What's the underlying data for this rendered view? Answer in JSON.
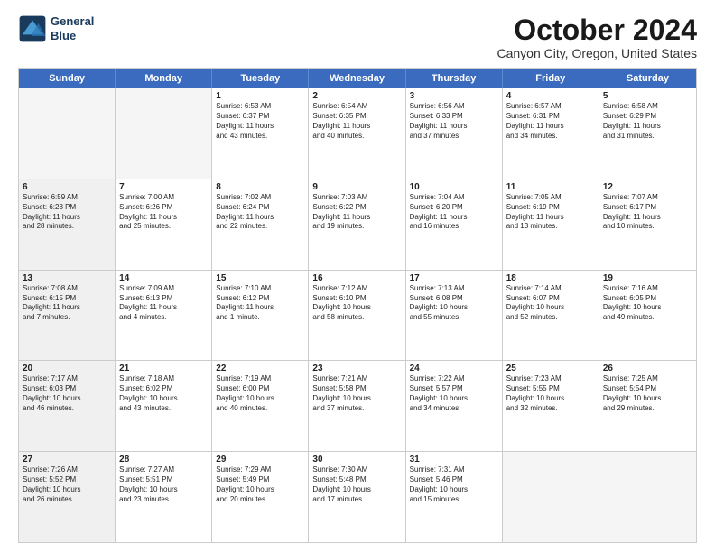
{
  "logo": {
    "line1": "General",
    "line2": "Blue"
  },
  "title": "October 2024",
  "subtitle": "Canyon City, Oregon, United States",
  "days_of_week": [
    "Sunday",
    "Monday",
    "Tuesday",
    "Wednesday",
    "Thursday",
    "Friday",
    "Saturday"
  ],
  "weeks": [
    [
      {
        "day": "",
        "empty": true
      },
      {
        "day": "",
        "empty": true
      },
      {
        "day": "1",
        "l1": "Sunrise: 6:53 AM",
        "l2": "Sunset: 6:37 PM",
        "l3": "Daylight: 11 hours",
        "l4": "and 43 minutes."
      },
      {
        "day": "2",
        "l1": "Sunrise: 6:54 AM",
        "l2": "Sunset: 6:35 PM",
        "l3": "Daylight: 11 hours",
        "l4": "and 40 minutes."
      },
      {
        "day": "3",
        "l1": "Sunrise: 6:56 AM",
        "l2": "Sunset: 6:33 PM",
        "l3": "Daylight: 11 hours",
        "l4": "and 37 minutes."
      },
      {
        "day": "4",
        "l1": "Sunrise: 6:57 AM",
        "l2": "Sunset: 6:31 PM",
        "l3": "Daylight: 11 hours",
        "l4": "and 34 minutes."
      },
      {
        "day": "5",
        "l1": "Sunrise: 6:58 AM",
        "l2": "Sunset: 6:29 PM",
        "l3": "Daylight: 11 hours",
        "l4": "and 31 minutes."
      }
    ],
    [
      {
        "day": "6",
        "shaded": true,
        "l1": "Sunrise: 6:59 AM",
        "l2": "Sunset: 6:28 PM",
        "l3": "Daylight: 11 hours",
        "l4": "and 28 minutes."
      },
      {
        "day": "7",
        "l1": "Sunrise: 7:00 AM",
        "l2": "Sunset: 6:26 PM",
        "l3": "Daylight: 11 hours",
        "l4": "and 25 minutes."
      },
      {
        "day": "8",
        "l1": "Sunrise: 7:02 AM",
        "l2": "Sunset: 6:24 PM",
        "l3": "Daylight: 11 hours",
        "l4": "and 22 minutes."
      },
      {
        "day": "9",
        "l1": "Sunrise: 7:03 AM",
        "l2": "Sunset: 6:22 PM",
        "l3": "Daylight: 11 hours",
        "l4": "and 19 minutes."
      },
      {
        "day": "10",
        "l1": "Sunrise: 7:04 AM",
        "l2": "Sunset: 6:20 PM",
        "l3": "Daylight: 11 hours",
        "l4": "and 16 minutes."
      },
      {
        "day": "11",
        "l1": "Sunrise: 7:05 AM",
        "l2": "Sunset: 6:19 PM",
        "l3": "Daylight: 11 hours",
        "l4": "and 13 minutes."
      },
      {
        "day": "12",
        "l1": "Sunrise: 7:07 AM",
        "l2": "Sunset: 6:17 PM",
        "l3": "Daylight: 11 hours",
        "l4": "and 10 minutes."
      }
    ],
    [
      {
        "day": "13",
        "shaded": true,
        "l1": "Sunrise: 7:08 AM",
        "l2": "Sunset: 6:15 PM",
        "l3": "Daylight: 11 hours",
        "l4": "and 7 minutes."
      },
      {
        "day": "14",
        "l1": "Sunrise: 7:09 AM",
        "l2": "Sunset: 6:13 PM",
        "l3": "Daylight: 11 hours",
        "l4": "and 4 minutes."
      },
      {
        "day": "15",
        "l1": "Sunrise: 7:10 AM",
        "l2": "Sunset: 6:12 PM",
        "l3": "Daylight: 11 hours",
        "l4": "and 1 minute."
      },
      {
        "day": "16",
        "l1": "Sunrise: 7:12 AM",
        "l2": "Sunset: 6:10 PM",
        "l3": "Daylight: 10 hours",
        "l4": "and 58 minutes."
      },
      {
        "day": "17",
        "l1": "Sunrise: 7:13 AM",
        "l2": "Sunset: 6:08 PM",
        "l3": "Daylight: 10 hours",
        "l4": "and 55 minutes."
      },
      {
        "day": "18",
        "l1": "Sunrise: 7:14 AM",
        "l2": "Sunset: 6:07 PM",
        "l3": "Daylight: 10 hours",
        "l4": "and 52 minutes."
      },
      {
        "day": "19",
        "l1": "Sunrise: 7:16 AM",
        "l2": "Sunset: 6:05 PM",
        "l3": "Daylight: 10 hours",
        "l4": "and 49 minutes."
      }
    ],
    [
      {
        "day": "20",
        "shaded": true,
        "l1": "Sunrise: 7:17 AM",
        "l2": "Sunset: 6:03 PM",
        "l3": "Daylight: 10 hours",
        "l4": "and 46 minutes."
      },
      {
        "day": "21",
        "l1": "Sunrise: 7:18 AM",
        "l2": "Sunset: 6:02 PM",
        "l3": "Daylight: 10 hours",
        "l4": "and 43 minutes."
      },
      {
        "day": "22",
        "l1": "Sunrise: 7:19 AM",
        "l2": "Sunset: 6:00 PM",
        "l3": "Daylight: 10 hours",
        "l4": "and 40 minutes."
      },
      {
        "day": "23",
        "l1": "Sunrise: 7:21 AM",
        "l2": "Sunset: 5:58 PM",
        "l3": "Daylight: 10 hours",
        "l4": "and 37 minutes."
      },
      {
        "day": "24",
        "l1": "Sunrise: 7:22 AM",
        "l2": "Sunset: 5:57 PM",
        "l3": "Daylight: 10 hours",
        "l4": "and 34 minutes."
      },
      {
        "day": "25",
        "l1": "Sunrise: 7:23 AM",
        "l2": "Sunset: 5:55 PM",
        "l3": "Daylight: 10 hours",
        "l4": "and 32 minutes."
      },
      {
        "day": "26",
        "l1": "Sunrise: 7:25 AM",
        "l2": "Sunset: 5:54 PM",
        "l3": "Daylight: 10 hours",
        "l4": "and 29 minutes."
      }
    ],
    [
      {
        "day": "27",
        "shaded": true,
        "l1": "Sunrise: 7:26 AM",
        "l2": "Sunset: 5:52 PM",
        "l3": "Daylight: 10 hours",
        "l4": "and 26 minutes."
      },
      {
        "day": "28",
        "l1": "Sunrise: 7:27 AM",
        "l2": "Sunset: 5:51 PM",
        "l3": "Daylight: 10 hours",
        "l4": "and 23 minutes."
      },
      {
        "day": "29",
        "l1": "Sunrise: 7:29 AM",
        "l2": "Sunset: 5:49 PM",
        "l3": "Daylight: 10 hours",
        "l4": "and 20 minutes."
      },
      {
        "day": "30",
        "l1": "Sunrise: 7:30 AM",
        "l2": "Sunset: 5:48 PM",
        "l3": "Daylight: 10 hours",
        "l4": "and 17 minutes."
      },
      {
        "day": "31",
        "l1": "Sunrise: 7:31 AM",
        "l2": "Sunset: 5:46 PM",
        "l3": "Daylight: 10 hours",
        "l4": "and 15 minutes."
      },
      {
        "day": "",
        "empty": true
      },
      {
        "day": "",
        "empty": true
      }
    ]
  ]
}
